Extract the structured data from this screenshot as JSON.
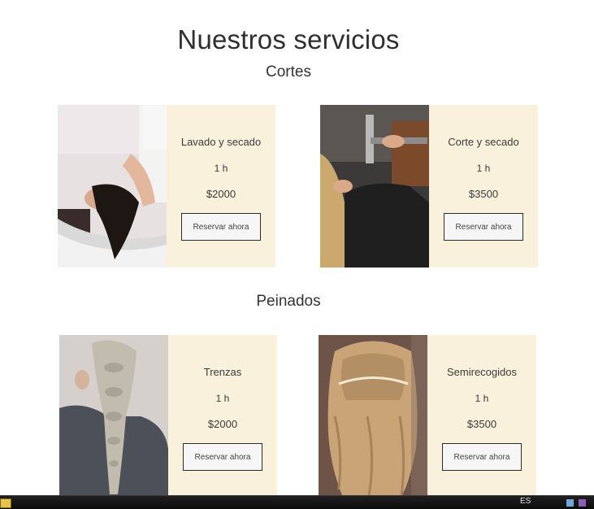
{
  "page": {
    "title": "Nuestros servicios"
  },
  "sections": [
    {
      "title": "Cortes",
      "items": [
        {
          "name": "Lavado y secado",
          "duration": "1 h",
          "price": "$2000",
          "button": "Reservar ahora",
          "image_icon": "hair-wash-photo"
        },
        {
          "name": "Corte y secado",
          "duration": "1 h",
          "price": "$3500",
          "button": "Reservar ahora",
          "image_icon": "blow-dry-photo"
        }
      ]
    },
    {
      "title": "Peinados",
      "items": [
        {
          "name": "Trenzas",
          "duration": "1 h",
          "price": "$2000",
          "button": "Reservar ahora",
          "image_icon": "braid-photo"
        },
        {
          "name": "Semirecogidos",
          "duration": "1 h",
          "price": "$3500",
          "button": "Reservar ahora",
          "image_icon": "half-updo-photo"
        }
      ]
    }
  ],
  "taskbar": {
    "lang": "ES"
  },
  "colors": {
    "card_background": "#faf1dc",
    "button_border": "#2b2b2b",
    "text": "#333333"
  }
}
